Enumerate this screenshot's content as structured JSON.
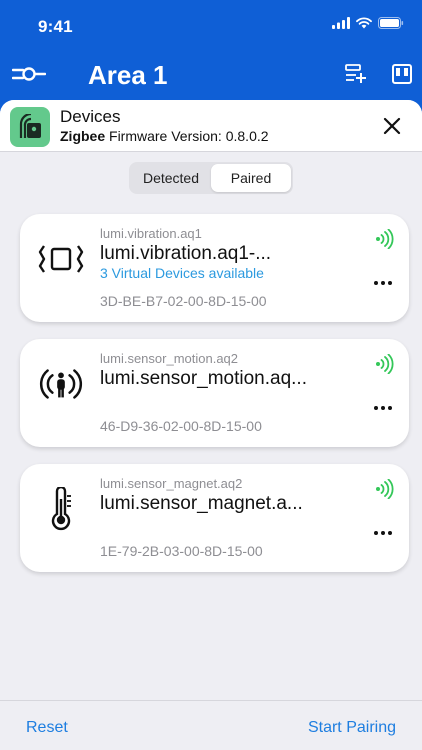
{
  "status_bar": {
    "time": "9:41"
  },
  "nav": {
    "title": "Area 1"
  },
  "sheet": {
    "title": "Devices",
    "subtitle_bold": "Zigbee",
    "subtitle_rest": " Firmware Version: 0.8.0.2"
  },
  "segments": [
    {
      "label": "Detected",
      "active": false
    },
    {
      "label": "Paired",
      "active": true
    }
  ],
  "devices": [
    {
      "model": "lumi.vibration.aq1",
      "name": "lumi.vibration.aq1-...",
      "virtual": "3 Virtual Devices available",
      "mac": "3D-BE-B7-02-00-8D-15-00",
      "icon": "vibration-icon"
    },
    {
      "model": "lumi.sensor_motion.aq2",
      "name": "lumi.sensor_motion.aq...",
      "virtual": "",
      "mac": "46-D9-36-02-00-8D-15-00",
      "icon": "motion-sensor-icon"
    },
    {
      "model": "lumi.sensor_magnet.aq2",
      "name": "lumi.sensor_magnet.a...",
      "virtual": "",
      "mac": "1E-79-2B-03-00-8D-15-00",
      "icon": "thermometer-icon"
    }
  ],
  "toolbar": {
    "reset": "Reset",
    "start": "Start Pairing"
  },
  "colors": {
    "brand": "#0f5fd6",
    "link": "#1e7ee0",
    "signal": "#34c759",
    "app_icon": "#63c98c"
  }
}
